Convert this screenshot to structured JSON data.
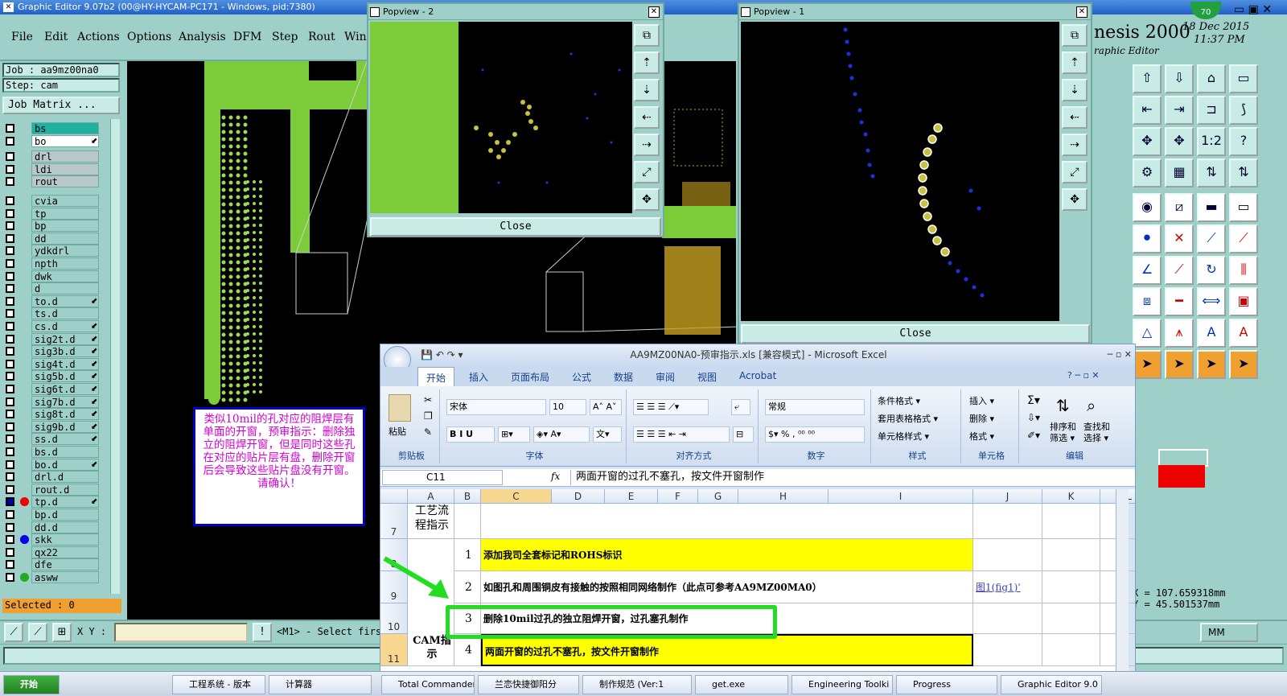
{
  "main_window": {
    "title": "Graphic Editor 9.07b2 (00@HY-HYCAM-PC171 - Windows, pid:7380)",
    "menu": [
      "File",
      "Edit",
      "Actions",
      "Options",
      "Analysis",
      "DFM",
      "Step",
      "Rout",
      "Win"
    ]
  },
  "left_panel": {
    "job": "Job : aa9mz00na0",
    "step": "Step: cam",
    "job_matrix": "Job Matrix ...",
    "selected": "Selected : 0",
    "layers": [
      "bs",
      "bo",
      "drl",
      "ldi",
      "rout",
      "cvia",
      "tp",
      "bp",
      "dd",
      "ydkdrl",
      "npth",
      "dwk",
      "d",
      "to.d",
      "ts.d",
      "cs.d",
      "sig2t.d",
      "sig3b.d",
      "sig4t.d",
      "sig5b.d",
      "sig6t.d",
      "sig7b.d",
      "sig8t.d",
      "sig9b.d",
      "ss.d",
      "bs.d",
      "bo.d",
      "drl.d",
      "rout.d",
      "tp.d",
      "bp.d",
      "dd.d",
      "skk",
      "qx22",
      "dfe",
      "asww"
    ]
  },
  "bottom_bar": {
    "xy_label": "X Y :",
    "xy_value": "",
    "prompt": "<M1> - Select firs",
    "units": "MM"
  },
  "popview2": {
    "title": "Popview - 2",
    "close": "Close"
  },
  "popview1": {
    "title": "Popview - 1",
    "close": "Close"
  },
  "genesis": {
    "brand": "nesis 2000",
    "sub": "raphic Editor",
    "date": "18 Dec 2015",
    "time": "11:37 PM",
    "badge": "70",
    "x_coord": "X  =  107.659318mm",
    "y_coord": "Y  =  45.501537mm"
  },
  "note": "类似10mil的孔对应的阻焊层有单面的开窗，预审指示：删除独立的阻焊开窗，但是同时这些孔在对应的贴片层有盘，删除开窗后会导致这些贴片盘没有开窗。请确认！",
  "excel": {
    "title": "AA9MZ00NA0-预审指示.xls  [兼容模式] - Microsoft Excel",
    "tabs": [
      "开始",
      "插入",
      "页面布局",
      "公式",
      "数据",
      "审阅",
      "视图",
      "Acrobat"
    ],
    "clipboard": {
      "paste": "粘贴",
      "group": "剪贴板"
    },
    "font": {
      "name": "宋体",
      "size": "10",
      "group": "字体"
    },
    "alignment_group": "对齐方式",
    "number": {
      "format": "常规",
      "group": "数字"
    },
    "styles": {
      "items": [
        "条件格式 ▾",
        "套用表格格式 ▾",
        "单元格样式 ▾"
      ],
      "group": "样式"
    },
    "cells_group": {
      "items": [
        "插入 ▾",
        "删除 ▾",
        "格式 ▾"
      ],
      "group": "单元格"
    },
    "editing": {
      "sort": "排序和筛选 ▾",
      "find": "查找和选择 ▾",
      "group": "编辑"
    },
    "namebox": "C11",
    "fx": "fx",
    "formula": "两面开窗的过孔不塞孔，按文件开窗制作",
    "columns": [
      "A",
      "B",
      "C",
      "D",
      "E",
      "F",
      "G",
      "H",
      "I",
      "J",
      "K",
      "L"
    ],
    "rows": [
      {
        "num": "7",
        "a": "工艺流程指示",
        "b": "",
        "c": "",
        "j": ""
      },
      {
        "num": "8",
        "a": "",
        "b": "1",
        "c": "添加我司全套标记和ROHS标识",
        "j": ""
      },
      {
        "num": "9",
        "a": "",
        "b": "2",
        "c": "如图孔和周围铜皮有接触的按照相同网络制作（此点可参考AA9MZ00MA0）",
        "j": "图1(fig1)'"
      },
      {
        "num": "10",
        "a": "",
        "b": "3",
        "c": "删除10mil过孔的独立阻焊开窗，过孔塞孔制作",
        "j": ""
      },
      {
        "num": "11",
        "a": "CAM指示",
        "b": "4",
        "c": "两面开窗的过孔不塞孔，按文件开窗制作",
        "j": ""
      }
    ]
  },
  "taskbar": [
    "开始",
    "工程系统 - 版本",
    "计算器",
    "Total Commander",
    "兰恋快捷御阳分",
    "制作规范 (Ver:1",
    "get.exe",
    "Engineering Toolki",
    "Progress",
    "Graphic Editor 9.0"
  ],
  "colors": {
    "accent": "#9fcfc9",
    "green_highlight": "#22dd22",
    "yellow": "#ffff00"
  }
}
